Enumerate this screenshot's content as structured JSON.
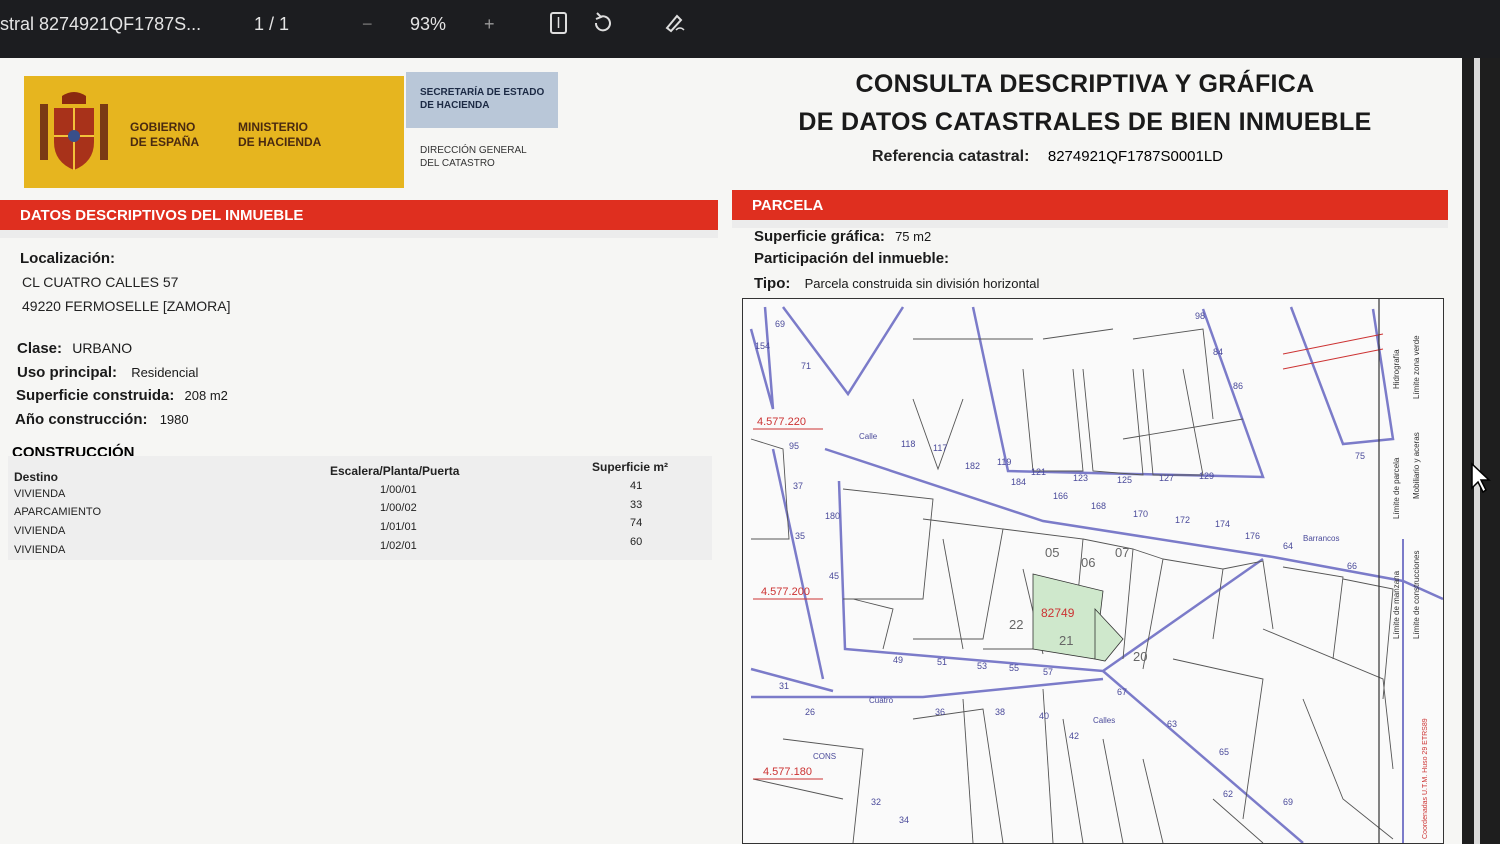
{
  "toolbar": {
    "doc_title": "stral 8274921QF1787S...",
    "page_indicator": "1  /  1",
    "minus": "−",
    "zoom": "93%",
    "plus": "+",
    "icons": [
      "fit-page-icon",
      "rotate-icon",
      "annotate-icon"
    ]
  },
  "header": {
    "gov_line1": "GOBIERNO",
    "gov_line2": "DE ESPAÑA",
    "ministry_line1": "MINISTERIO",
    "ministry_line2": "DE HACIENDA",
    "secretaria": "SECRETARÍA DE ESTADO DE HACIENDA",
    "direccion_line1": "DIRECCIÓN GENERAL",
    "direccion_line2": "DEL CATASTRO",
    "title_line1": "CONSULTA DESCRIPTIVA Y GRÁFICA",
    "title_line2": "DE DATOS CATASTRALES DE BIEN INMUEBLE",
    "ref_label": "Referencia catastral:",
    "ref_value": "8274921QF1787S0001LD"
  },
  "left": {
    "band": "DATOS DESCRIPTIVOS DEL INMUEBLE",
    "localizacion_label": "Localización:",
    "address1": "CL CUATRO CALLES 57",
    "address2": "49220 FERMOSELLE [ZAMORA]",
    "clase_label": "Clase:",
    "clase_value": "URBANO",
    "uso_label": "Uso principal:",
    "uso_value": "Residencial",
    "sup_label": "Superficie construida:",
    "sup_value": "208 m2",
    "anio_label": "Año construcción:",
    "anio_value": "1980",
    "construccion_title": "CONSTRUCCIÓN",
    "col_destino": "Destino",
    "col_escalera": "Escalera/Planta/Puerta",
    "col_superficie": "Superficie m²",
    "rows": [
      {
        "destino": "VIVIENDA",
        "escalera": "1/00/01",
        "superficie": "41"
      },
      {
        "destino": "APARCAMIENTO",
        "escalera": "1/00/02",
        "superficie": "33"
      },
      {
        "destino": "VIVIENDA",
        "escalera": "1/01/01",
        "superficie": "74"
      },
      {
        "destino": "VIVIENDA",
        "escalera": "1/02/01",
        "superficie": "60"
      }
    ]
  },
  "right": {
    "band": "PARCELA",
    "sup_label": "Superficie gráfica:",
    "sup_value": "75 m2",
    "part_label": "Participación del inmueble:",
    "tipo_label": "Tipo:",
    "tipo_value": "Parcela construida sin división horizontal"
  },
  "map": {
    "coords": [
      "4.577.220",
      "4.577.200",
      "4.577.180"
    ],
    "parcel_ref": "82749",
    "parcel_numbers": [
      "05",
      "06",
      "07",
      "22",
      "21",
      "20"
    ],
    "street_labels": [
      "Calle",
      "Cuatro",
      "Calles",
      "Barrancos",
      "CONS"
    ],
    "house_numbers": [
      "69",
      "154",
      "71",
      "75",
      "95",
      "98",
      "84",
      "86",
      "118",
      "117",
      "182",
      "119",
      "121",
      "123",
      "125",
      "127",
      "129",
      "184",
      "166",
      "168",
      "170",
      "172",
      "174",
      "176",
      "64",
      "66",
      "180",
      "37",
      "35",
      "45",
      "49",
      "51",
      "53",
      "55",
      "57",
      "67",
      "31",
      "26",
      "36",
      "38",
      "40",
      "42",
      "63",
      "65",
      "62",
      "69",
      "32",
      "34"
    ],
    "legend_left1": "Límite de parcela",
    "legend_left2": "Mobiliario y aceras",
    "legend_left3": "Límite de manzana",
    "legend_left4": "Límite de construcciones",
    "legend_right1": "Hidrografía",
    "legend_right2": "Límite zona verde",
    "legend_bottom": "Coordenadas U.T.M. Huso 29 ETRS89"
  },
  "colors": {
    "band_red": "#df2f1f",
    "gov_yellow": "#e6b51f",
    "sec_blue": "#b9c7d8",
    "parcel_line": "#7b7bc9",
    "highlight_parcel": "#cfe8cc"
  }
}
